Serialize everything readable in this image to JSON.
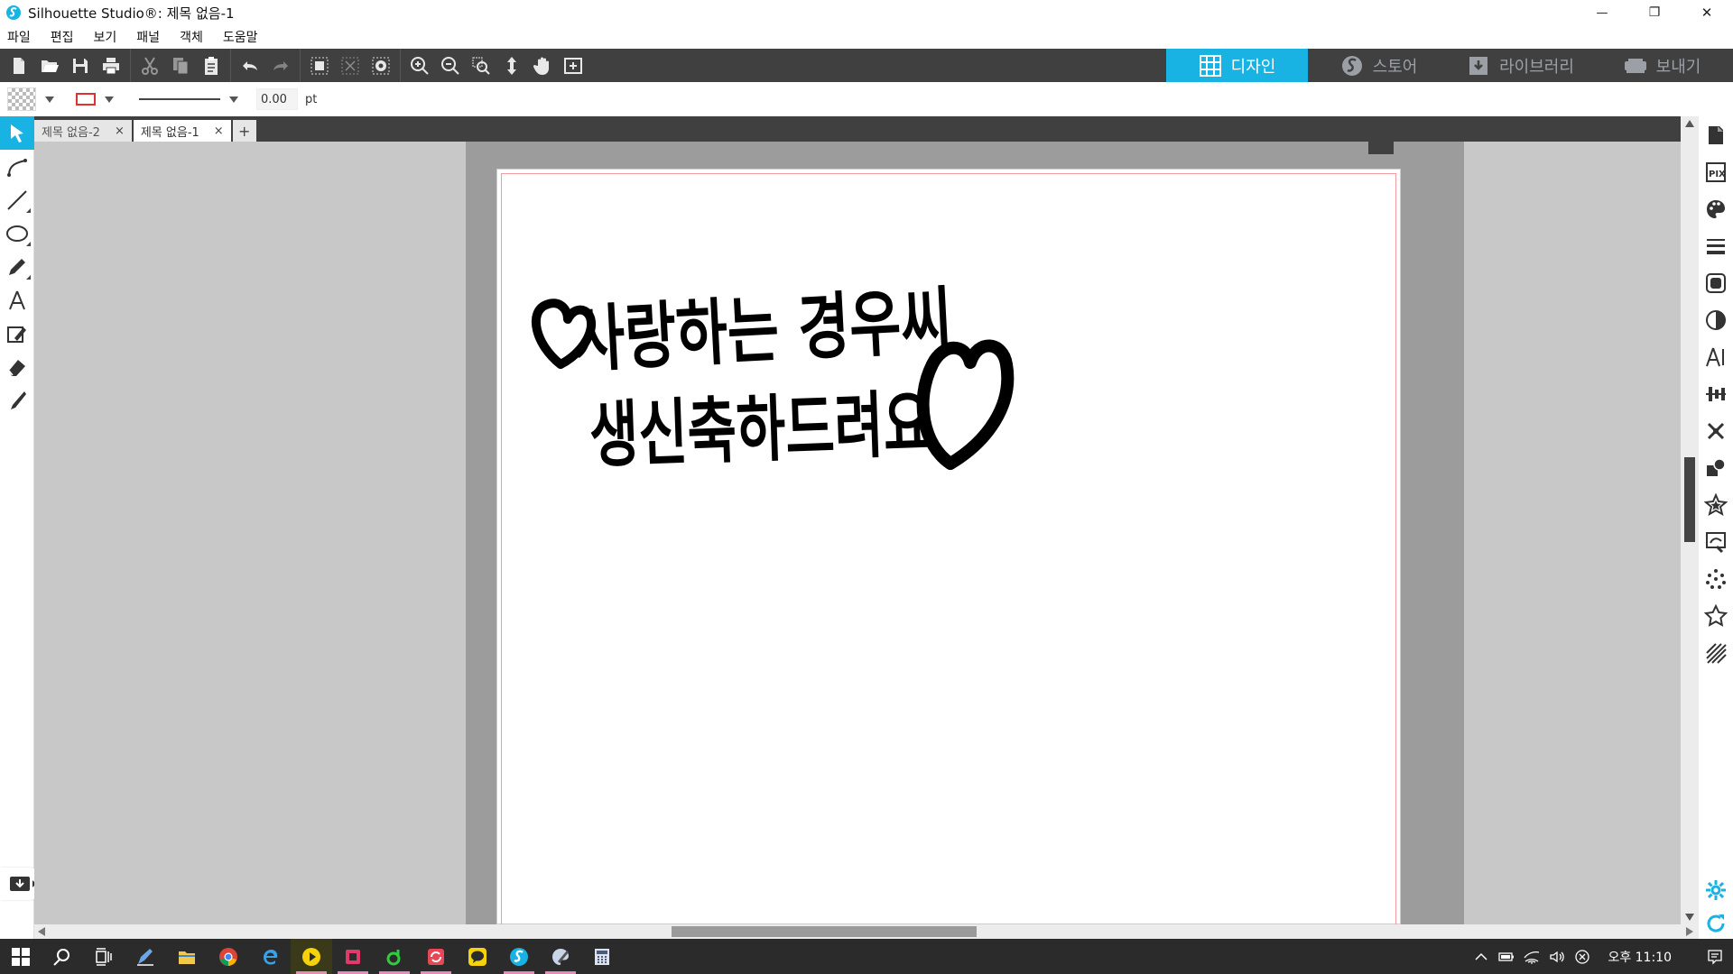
{
  "window": {
    "title": "Silhouette Studio®: 제목 없음-1",
    "minimize_glyph": "—",
    "maximize_glyph": "❐",
    "close_glyph": "✕"
  },
  "menu": [
    "파일",
    "편집",
    "보기",
    "패널",
    "객체",
    "도움말"
  ],
  "mode_tabs": [
    {
      "label": "디자인",
      "icon": "grid-icon",
      "active": true
    },
    {
      "label": "스토어",
      "icon": "store-logo-icon",
      "active": false
    },
    {
      "label": "라이브러리",
      "icon": "library-download-icon",
      "active": false
    },
    {
      "label": "보내기",
      "icon": "cutter-icon",
      "active": false
    }
  ],
  "properties": {
    "stroke_width": "0.00",
    "unit": "pt",
    "stroke_color": "#e03030"
  },
  "doc_tabs": [
    {
      "label": "제목 없음-2",
      "active": false
    },
    {
      "label": "제목 없음-1",
      "active": true
    }
  ],
  "doc_tab_close_glyph": "×",
  "doc_tab_add_glyph": "+",
  "design": {
    "line1": "사랑하는 경우씨",
    "line2": "생신축하드려요"
  },
  "taskbar": {
    "time": "오후 11:10"
  },
  "colors": {
    "accent": "#19b3e3",
    "toolbar": "#404040",
    "cut_border": "#f39aa2"
  }
}
